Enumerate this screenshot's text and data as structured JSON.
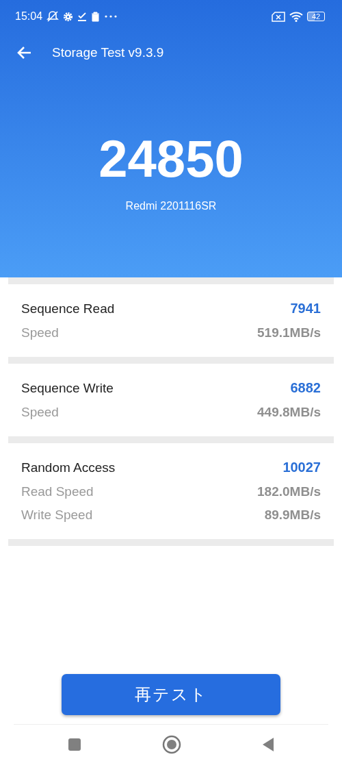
{
  "status_bar": {
    "time": "15:04",
    "battery": "42"
  },
  "toolbar": {
    "title": "Storage Test v9.3.9"
  },
  "result": {
    "score": "24850",
    "device": "Redmi 2201116SR"
  },
  "sections": [
    {
      "title": "Sequence Read",
      "score": "7941",
      "rows": [
        {
          "label": "Speed",
          "value": "519.1MB/s"
        }
      ]
    },
    {
      "title": "Sequence Write",
      "score": "6882",
      "rows": [
        {
          "label": "Speed",
          "value": "449.8MB/s"
        }
      ]
    },
    {
      "title": "Random Access",
      "score": "10027",
      "rows": [
        {
          "label": "Read Speed",
          "value": "182.0MB/s"
        },
        {
          "label": "Write Speed",
          "value": "89.9MB/s"
        }
      ]
    }
  ],
  "retest_button": {
    "label": "再テスト"
  }
}
